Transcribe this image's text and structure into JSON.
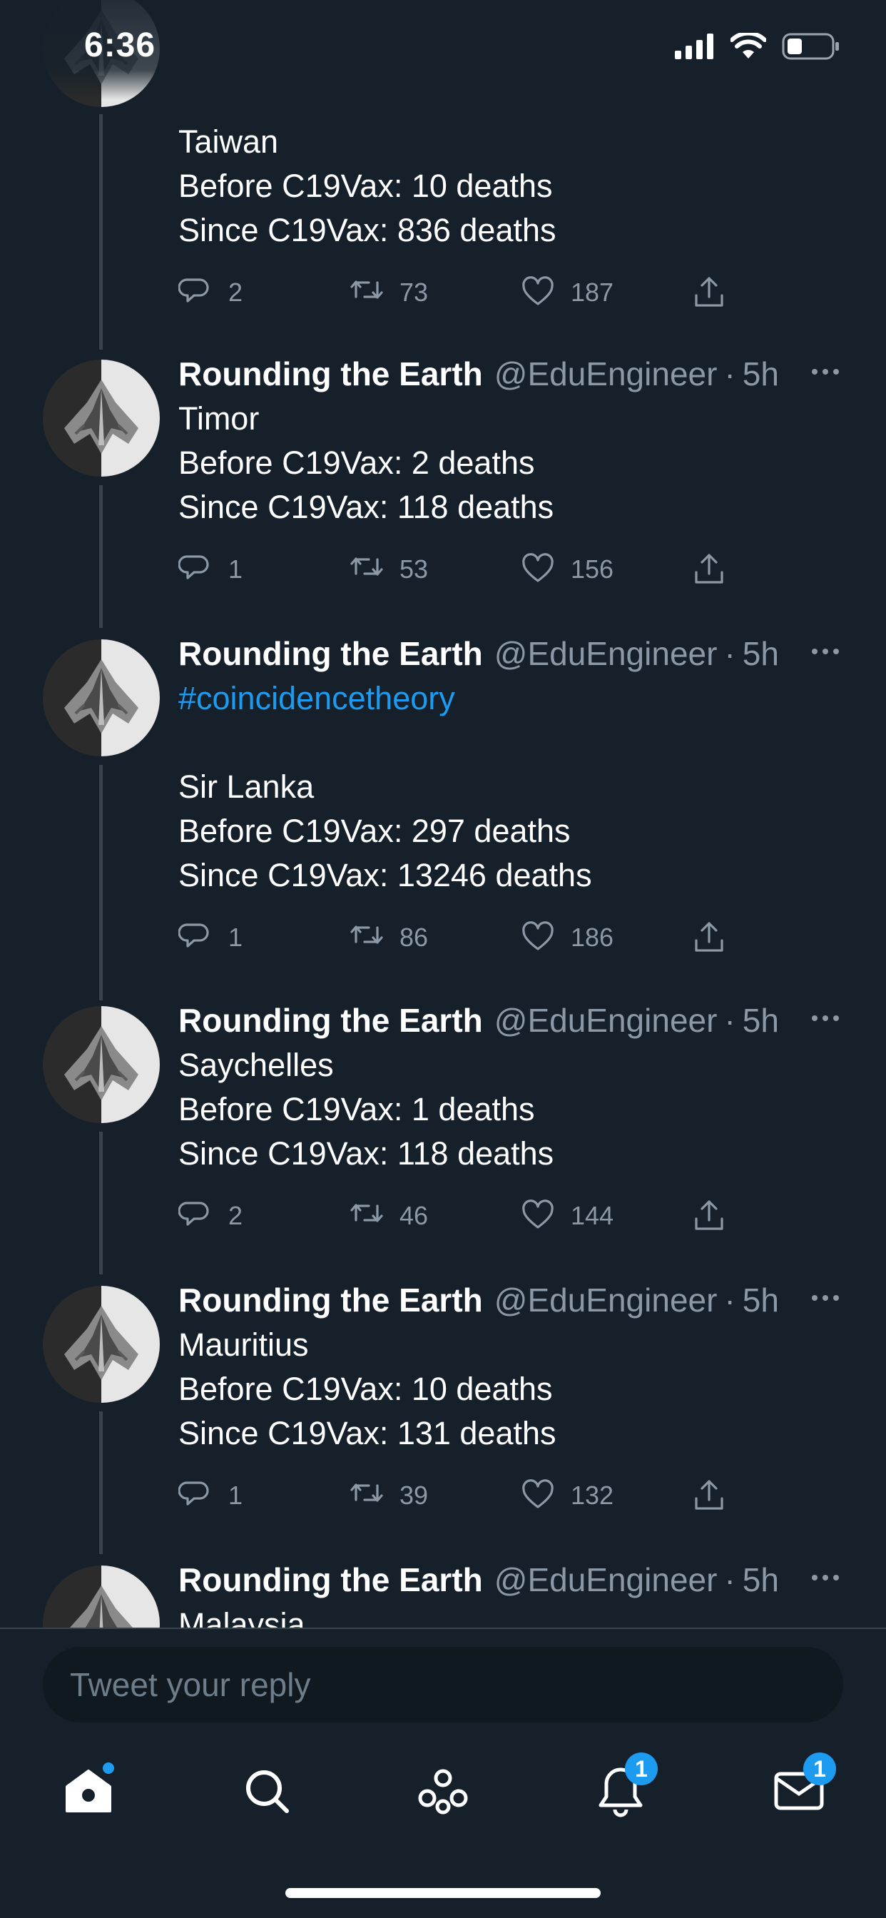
{
  "status_bar": {
    "time": "6:36"
  },
  "top_tweet": {
    "lines": [
      "Taiwan",
      "Before C19Vax: 10 deaths",
      "Since C19Vax: 836 deaths"
    ],
    "replies": "2",
    "retweets": "73",
    "likes": "187"
  },
  "tweets": [
    {
      "name": "Rounding the Earth",
      "handle": "@EduEngineer",
      "age": "5h",
      "lines": [
        "Timor",
        "Before C19Vax: 2 deaths",
        "Since C19Vax: 118 deaths"
      ],
      "replies": "1",
      "retweets": "53",
      "likes": "156"
    },
    {
      "name": "Rounding the Earth",
      "handle": "@EduEngineer",
      "age": "5h",
      "hashtag": "#coincidencetheory",
      "lines": [
        "Sir Lanka",
        "Before C19Vax: 297 deaths",
        "Since C19Vax: 13246 deaths"
      ],
      "replies": "1",
      "retweets": "86",
      "likes": "186"
    },
    {
      "name": "Rounding the Earth",
      "handle": "@EduEngineer",
      "age": "5h",
      "lines": [
        "Saychelles",
        "Before C19Vax: 1 deaths",
        "Since C19Vax: 118 deaths"
      ],
      "replies": "2",
      "retweets": "46",
      "likes": "144"
    },
    {
      "name": "Rounding the Earth",
      "handle": "@EduEngineer",
      "age": "5h",
      "lines": [
        "Mauritius",
        "Before C19Vax: 10 deaths",
        "Since C19Vax: 131 deaths"
      ],
      "replies": "1",
      "retweets": "39",
      "likes": "132"
    },
    {
      "name": "Rounding the Earth",
      "handle": "@EduEngineer",
      "age": "5h",
      "lines": [
        "Malaysia"
      ]
    }
  ],
  "reply_box": {
    "placeholder": "Tweet your reply"
  },
  "tab_bar": {
    "items": [
      "home-icon",
      "search-icon",
      "spaces-icon",
      "notifications-icon",
      "messages-icon"
    ],
    "notifications_badge": "1",
    "messages_badge": "1"
  },
  "colors": {
    "background": "#15202b",
    "accent": "#1d9bf0",
    "secondary_text": "#8b98a5"
  }
}
